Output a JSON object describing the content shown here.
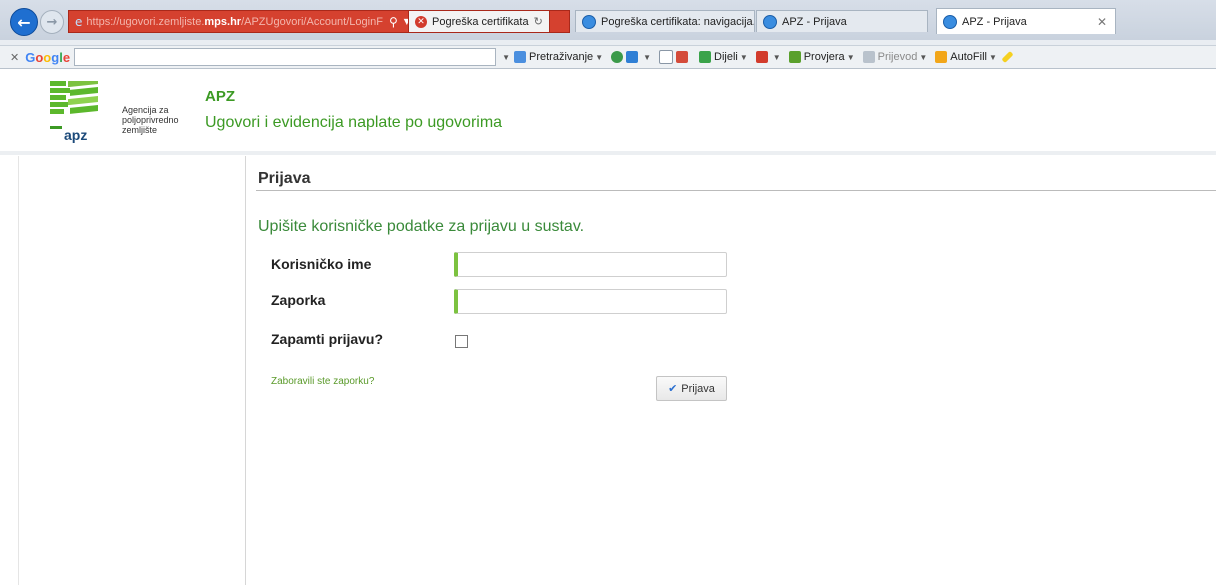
{
  "browser": {
    "address": {
      "url_prefix": "https://ugovori.zemljiste.",
      "url_host": "mps.hr",
      "url_path": "/APZUgovori/Account/LoginF",
      "search_icon": "search-icon",
      "dropdown_icon": "dropdown-icon"
    },
    "cert_error": {
      "label": "Pogreška certifikata"
    },
    "tabs": [
      {
        "label": "Pogreška certifikata: navigacija...",
        "active": false
      },
      {
        "label": "APZ - Prijava",
        "active": false
      },
      {
        "label": "APZ - Prijava",
        "active": true
      }
    ]
  },
  "toolbar": {
    "google": "Google",
    "items": [
      {
        "label": "Pretraživanje",
        "icon": "search-bar-icon",
        "muted": false
      },
      {
        "label": "Dijeli",
        "icon": "share-icon",
        "muted": false
      },
      {
        "label": "Provjera",
        "icon": "spellcheck-icon",
        "muted": false
      },
      {
        "label": "Prijevod",
        "icon": "translate-icon",
        "muted": true
      },
      {
        "label": "AutoFill",
        "icon": "autofill-icon",
        "muted": false
      }
    ]
  },
  "header": {
    "org_line1": "Agencija za",
    "org_line2": "poljoprivredno",
    "org_line3": "zemljište",
    "logo_text": "apz",
    "app_title": "APZ",
    "app_subtitle": "Ugovori i evidencija naplate po ugovorima"
  },
  "login": {
    "title": "Prijava",
    "intro": "Upišite korisničke podatke za prijavu u sustav.",
    "username_label": "Korisničko ime",
    "username_value": "",
    "password_label": "Zaporka",
    "password_value": "",
    "remember_label": "Zapamti prijavu?",
    "remember_checked": false,
    "forgot_link": "Zaboravili ste zaporku?",
    "submit_label": "Prijava"
  },
  "colors": {
    "accent_green": "#3c9a24",
    "input_accent": "#7cc240",
    "cert_error_red": "#d5412f"
  }
}
